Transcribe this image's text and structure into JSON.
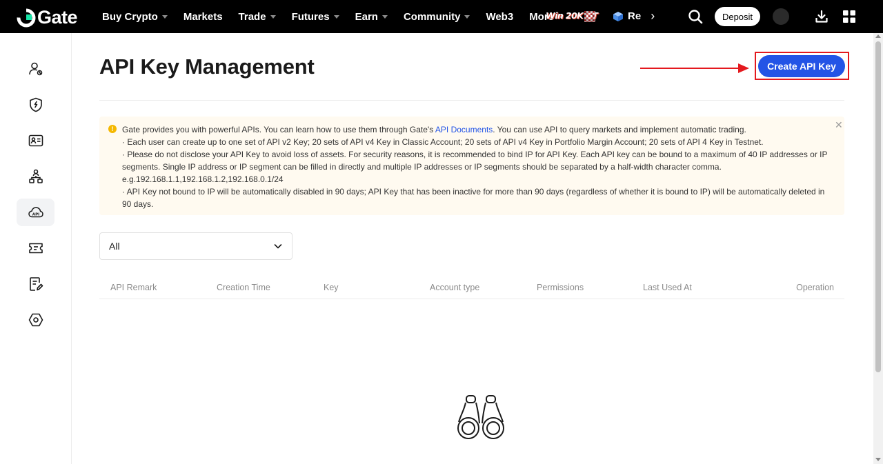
{
  "nav": {
    "logo_text": "Gate",
    "items": [
      {
        "label": "Buy Crypto",
        "caret": true
      },
      {
        "label": "Markets",
        "caret": false
      },
      {
        "label": "Trade",
        "caret": true
      },
      {
        "label": "Futures",
        "caret": true
      },
      {
        "label": "Earn",
        "caret": true
      },
      {
        "label": "Community",
        "caret": true
      },
      {
        "label": "Web3",
        "caret": false
      },
      {
        "label": "More",
        "caret": true
      }
    ],
    "promo_text": "Win 20K GT",
    "re_label": "Re",
    "deposit_label": "Deposit"
  },
  "sidebar": {
    "items": [
      {
        "icon": "user-icon",
        "active": false
      },
      {
        "icon": "security-shield-icon",
        "active": false
      },
      {
        "icon": "id-card-icon",
        "active": false
      },
      {
        "icon": "sub-account-icon",
        "active": false
      },
      {
        "icon": "api-cloud-icon",
        "active": true
      },
      {
        "icon": "coupon-icon",
        "active": false
      },
      {
        "icon": "edit-document-icon",
        "active": false
      },
      {
        "icon": "settings-hexagon-icon",
        "active": false
      }
    ]
  },
  "page": {
    "title": "API Key Management",
    "create_button": "Create API Key"
  },
  "notice": {
    "line1_prefix": "Gate provides you with powerful APIs. You can learn how to use them through Gate's ",
    "line1_link": "API Documents",
    "line1_suffix": ". You can use API to query markets and implement automatic trading.",
    "line2": " · Each user can create up to one set of API v2 Key; 20 sets of API v4 Key in Classic Account; 20 sets of API v4 Key in Portfolio Margin Account; 20 sets of API 4 Key in Testnet.",
    "line3": " · Please do not disclose your API Key to avoid loss of assets. For security reasons, it is recommended to bind IP for API Key. Each API key can be bound to a maximum of 40 IP addresses or IP segments. Single IP address or IP segment can be filled in directly and multiple IP addresses or IP segments should be separated by a half-width character comma.",
    "line4": "e.g.192.168.1.1,192.168.1.2,192.168.0.1/24",
    "line5": " · API Key not bound to IP will be automatically disabled in 90 days; API Key that has been inactive for more than 90 days (regardless of whether it is bound to IP) will be automatically deleted in 90 days."
  },
  "filter": {
    "selected": "All"
  },
  "table": {
    "columns": [
      "API Remark",
      "Creation Time",
      "Key",
      "Account type",
      "Permissions",
      "Last Used At",
      "Operation"
    ]
  },
  "colors": {
    "brand_blue": "#2354e6",
    "highlight_red": "#e4191e",
    "notice_bg": "#fffaf0",
    "warning_yellow": "#f5b800"
  }
}
